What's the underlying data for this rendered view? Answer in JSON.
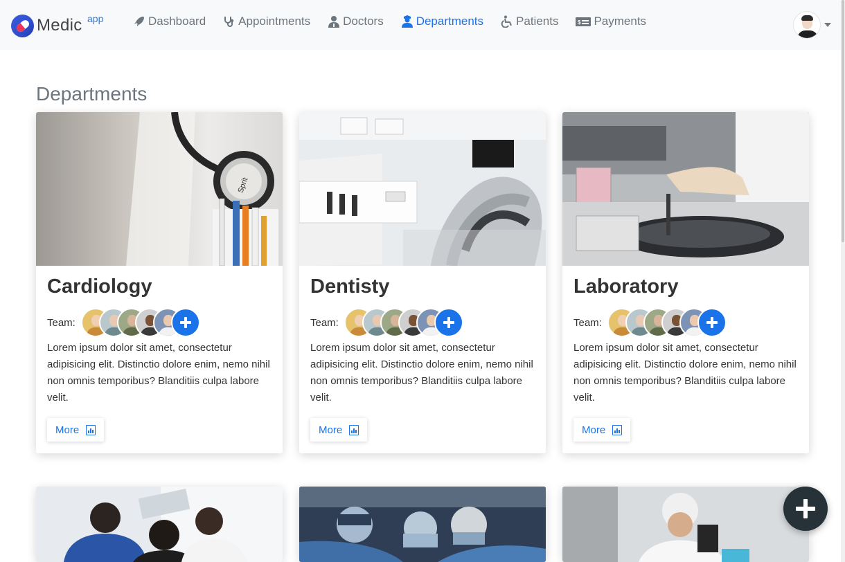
{
  "brand": {
    "name": "Medic",
    "sup": "app"
  },
  "nav": [
    {
      "label": "Dashboard",
      "icon": "rocket-icon",
      "active": false
    },
    {
      "label": "Appointments",
      "icon": "stethoscope-icon",
      "active": false
    },
    {
      "label": "Doctors",
      "icon": "user-md-icon",
      "active": false
    },
    {
      "label": "Departments",
      "icon": "user-nurse-icon",
      "active": true
    },
    {
      "label": "Patients",
      "icon": "wheelchair-icon",
      "active": false
    },
    {
      "label": "Payments",
      "icon": "money-bill-icon",
      "active": false
    }
  ],
  "page": {
    "title": "Departments"
  },
  "cards": [
    {
      "title": "Cardiology",
      "team_label": "Team:",
      "text": "Lorem ipsum dolor sit amet, consectetur adipisicing elit. Distinctio dolore enim, nemo nihil non omnis temporibus? Blanditiis culpa labore velit.",
      "more_label": "More",
      "image": "stethoscope-coat-photo"
    },
    {
      "title": "Dentisty",
      "team_label": "Team:",
      "text": "Lorem ipsum dolor sit amet, consectetur adipisicing elit. Distinctio dolore enim, nemo nihil non omnis temporibus? Blanditiis culpa labore velit.",
      "more_label": "More",
      "image": "dental-chair-photo"
    },
    {
      "title": "Laboratory",
      "team_label": "Team:",
      "text": "Lorem ipsum dolor sit amet, consectetur adipisicing elit. Distinctio dolore enim, nemo nihil non omnis temporibus? Blanditiis culpa labore velit.",
      "more_label": "More",
      "image": "lab-centrifuge-photo"
    },
    {
      "image": "doctors-xray-photo"
    },
    {
      "image": "surgery-team-photo"
    },
    {
      "image": "microscope-photo"
    }
  ],
  "colors": {
    "primary": "#1a73e8",
    "fab": "#263238",
    "muted": "#6c757d"
  }
}
